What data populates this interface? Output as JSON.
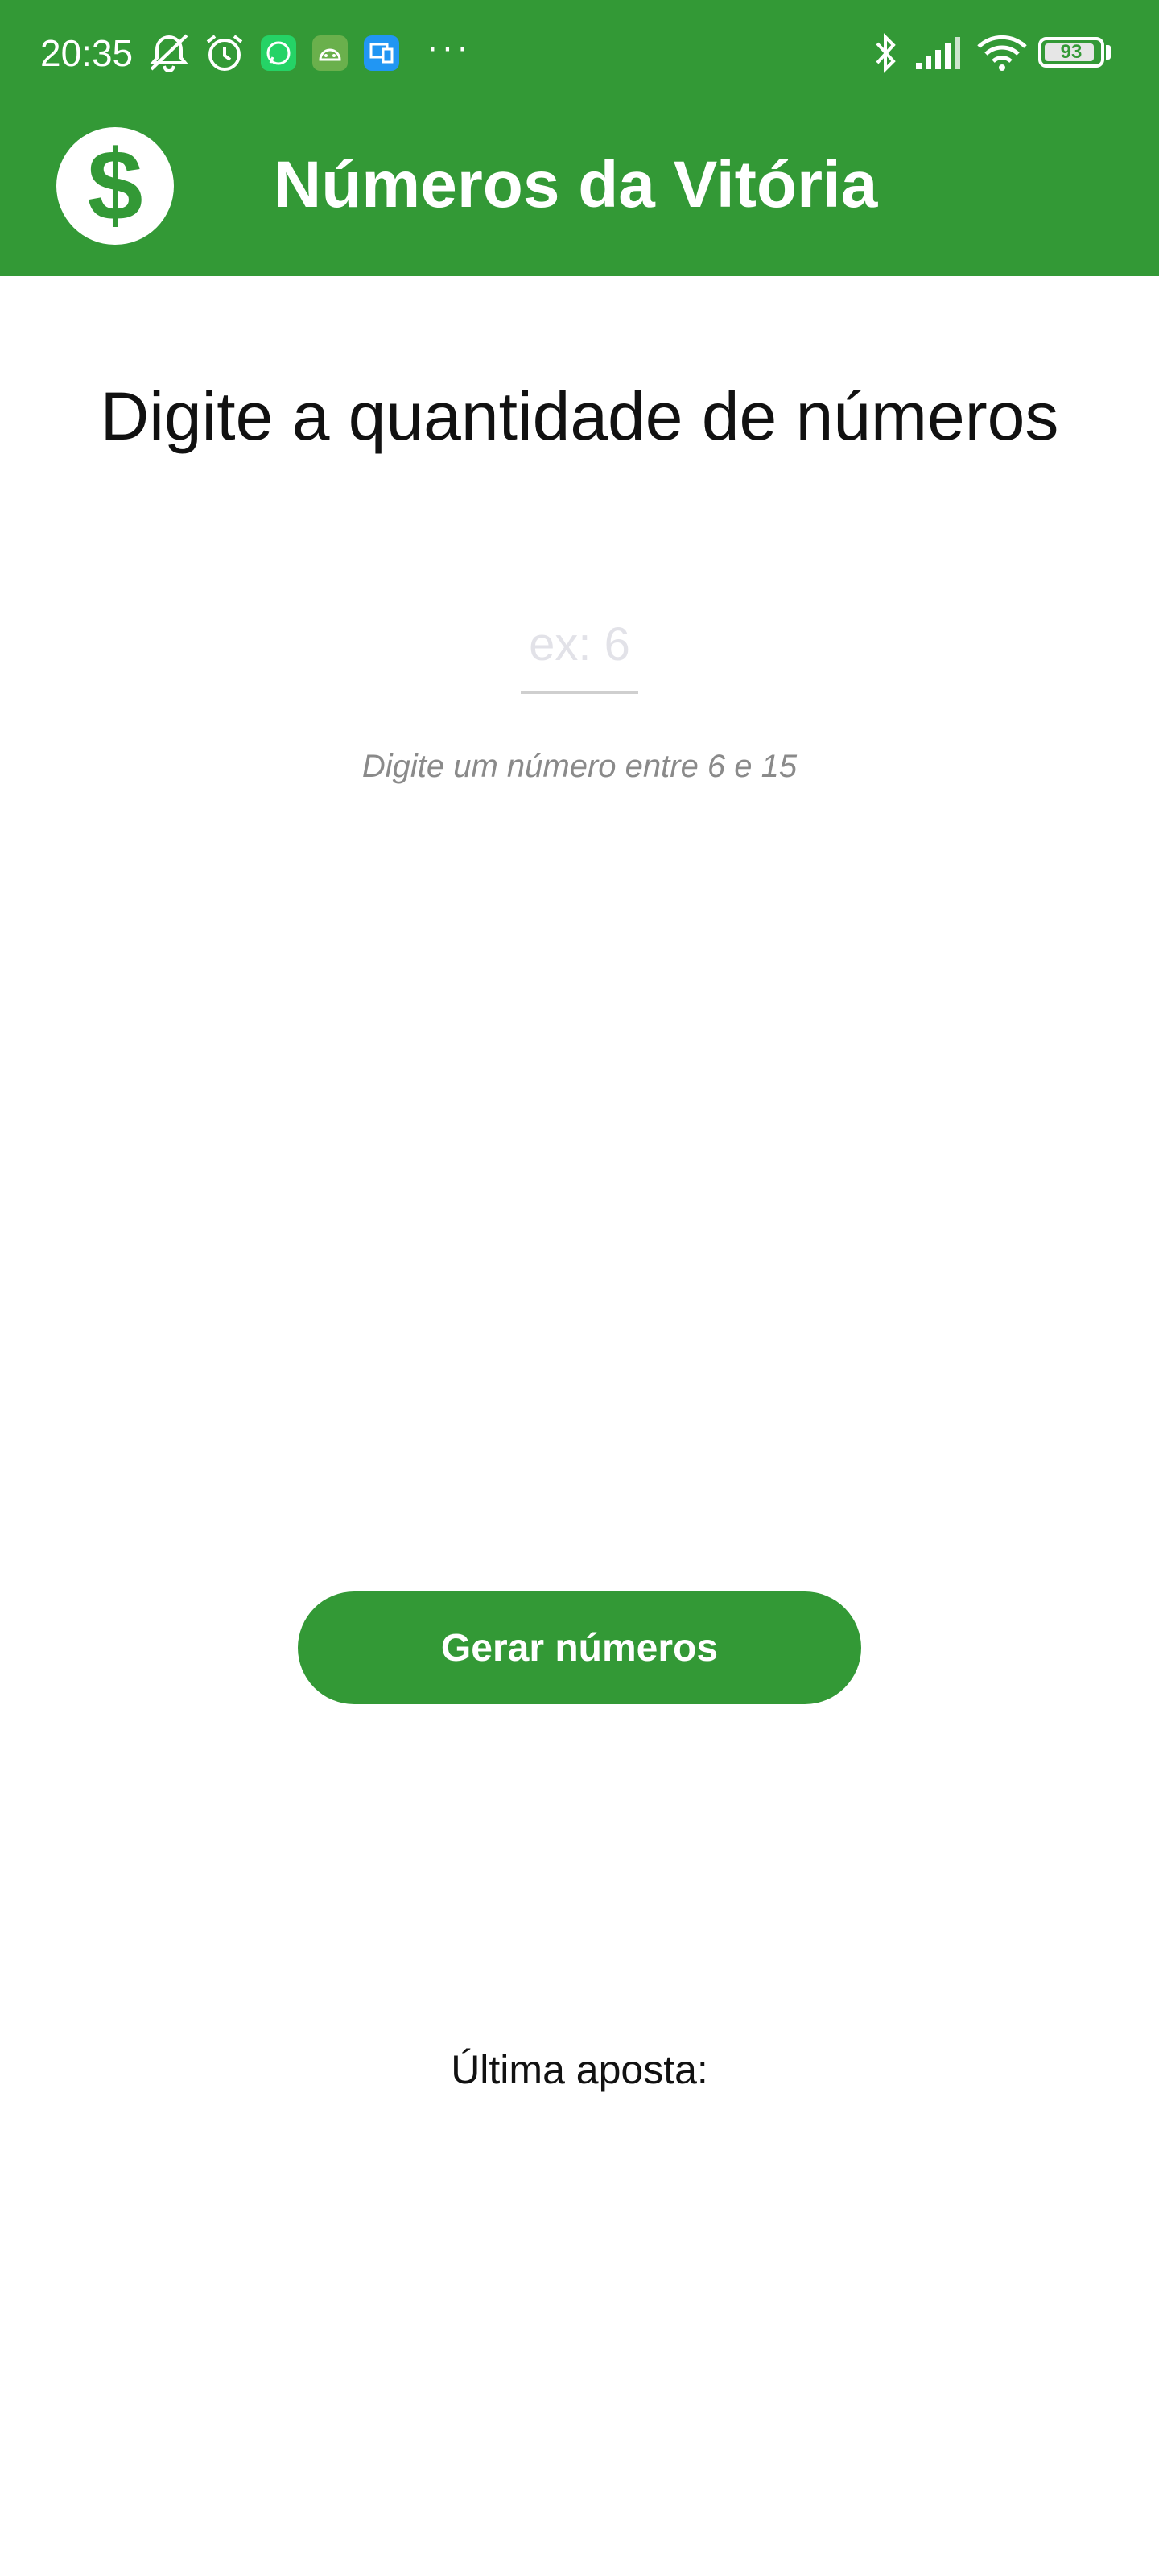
{
  "status_bar": {
    "time": "20:35",
    "battery": "93",
    "battery_level": 0.93,
    "icons": [
      "muted-bell-icon",
      "alarm-icon",
      "whatsapp-icon",
      "android-icon",
      "device-link-icon",
      "more-dots-icon",
      "bluetooth-icon",
      "signal-icon",
      "wifi-icon",
      "battery-icon"
    ],
    "more": "···"
  },
  "app_bar": {
    "logo_symbol": "$",
    "title": "Números da Vitória"
  },
  "main": {
    "heading": "Digite a quantidade de números",
    "input_placeholder": "ex: 6",
    "input_value": "",
    "helper_text": "Digite um número entre 6 e 15",
    "button_label": "Gerar números",
    "last_bet_label": "Última aposta:"
  },
  "colors": {
    "brand_green": "#339936",
    "background": "#ffffff",
    "text": "#111111",
    "helper": "#8a8a8a"
  }
}
